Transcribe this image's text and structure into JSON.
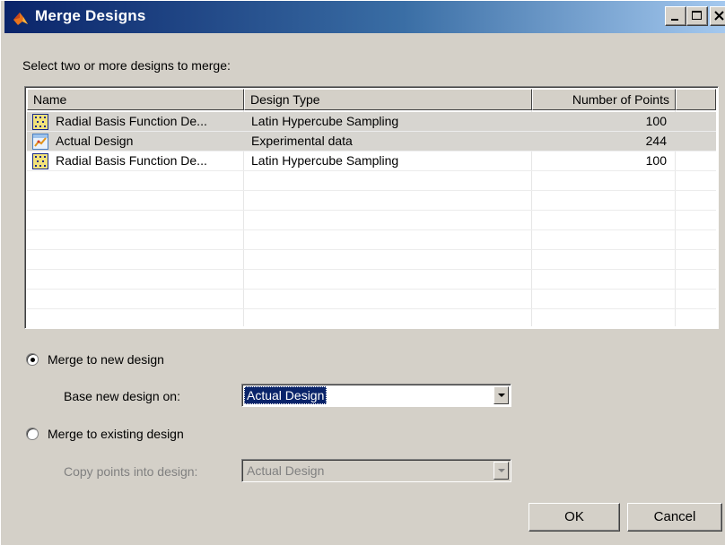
{
  "window": {
    "title": "Merge Designs",
    "controls": {
      "minimize_icon": "minimize-icon",
      "maximize_icon": "maximize-icon",
      "close_icon": "close-icon"
    }
  },
  "instruction": "Select two or more designs to merge:",
  "table": {
    "columns": [
      "Name",
      "Design Type",
      "Number of Points"
    ],
    "rows": [
      {
        "icon": "grid-design-icon",
        "name": "Radial Basis Function De...",
        "type": "Latin Hypercube Sampling",
        "points": "100"
      },
      {
        "icon": "experimental-data-icon",
        "name": "Actual Design",
        "type": "Experimental data",
        "points": "244"
      },
      {
        "icon": "grid-design-icon",
        "name": "Radial Basis Function De...",
        "type": "Latin Hypercube Sampling",
        "points": "100"
      }
    ]
  },
  "options": {
    "merge_new": {
      "label": "Merge to new design",
      "selected": true
    },
    "base_on": {
      "label": "Base new design on:",
      "value": "Actual Design"
    },
    "merge_existing": {
      "label": "Merge to existing design",
      "selected": false
    },
    "copy_into": {
      "label": "Copy points into design:",
      "value": "Actual Design",
      "enabled": false
    }
  },
  "buttons": {
    "ok": "OK",
    "cancel": "Cancel"
  },
  "colors": {
    "titlebar_start": "#0a246a",
    "titlebar_end": "#a6caf0",
    "dialog_bg": "#d4d0c8",
    "selection": "#0a246a"
  }
}
